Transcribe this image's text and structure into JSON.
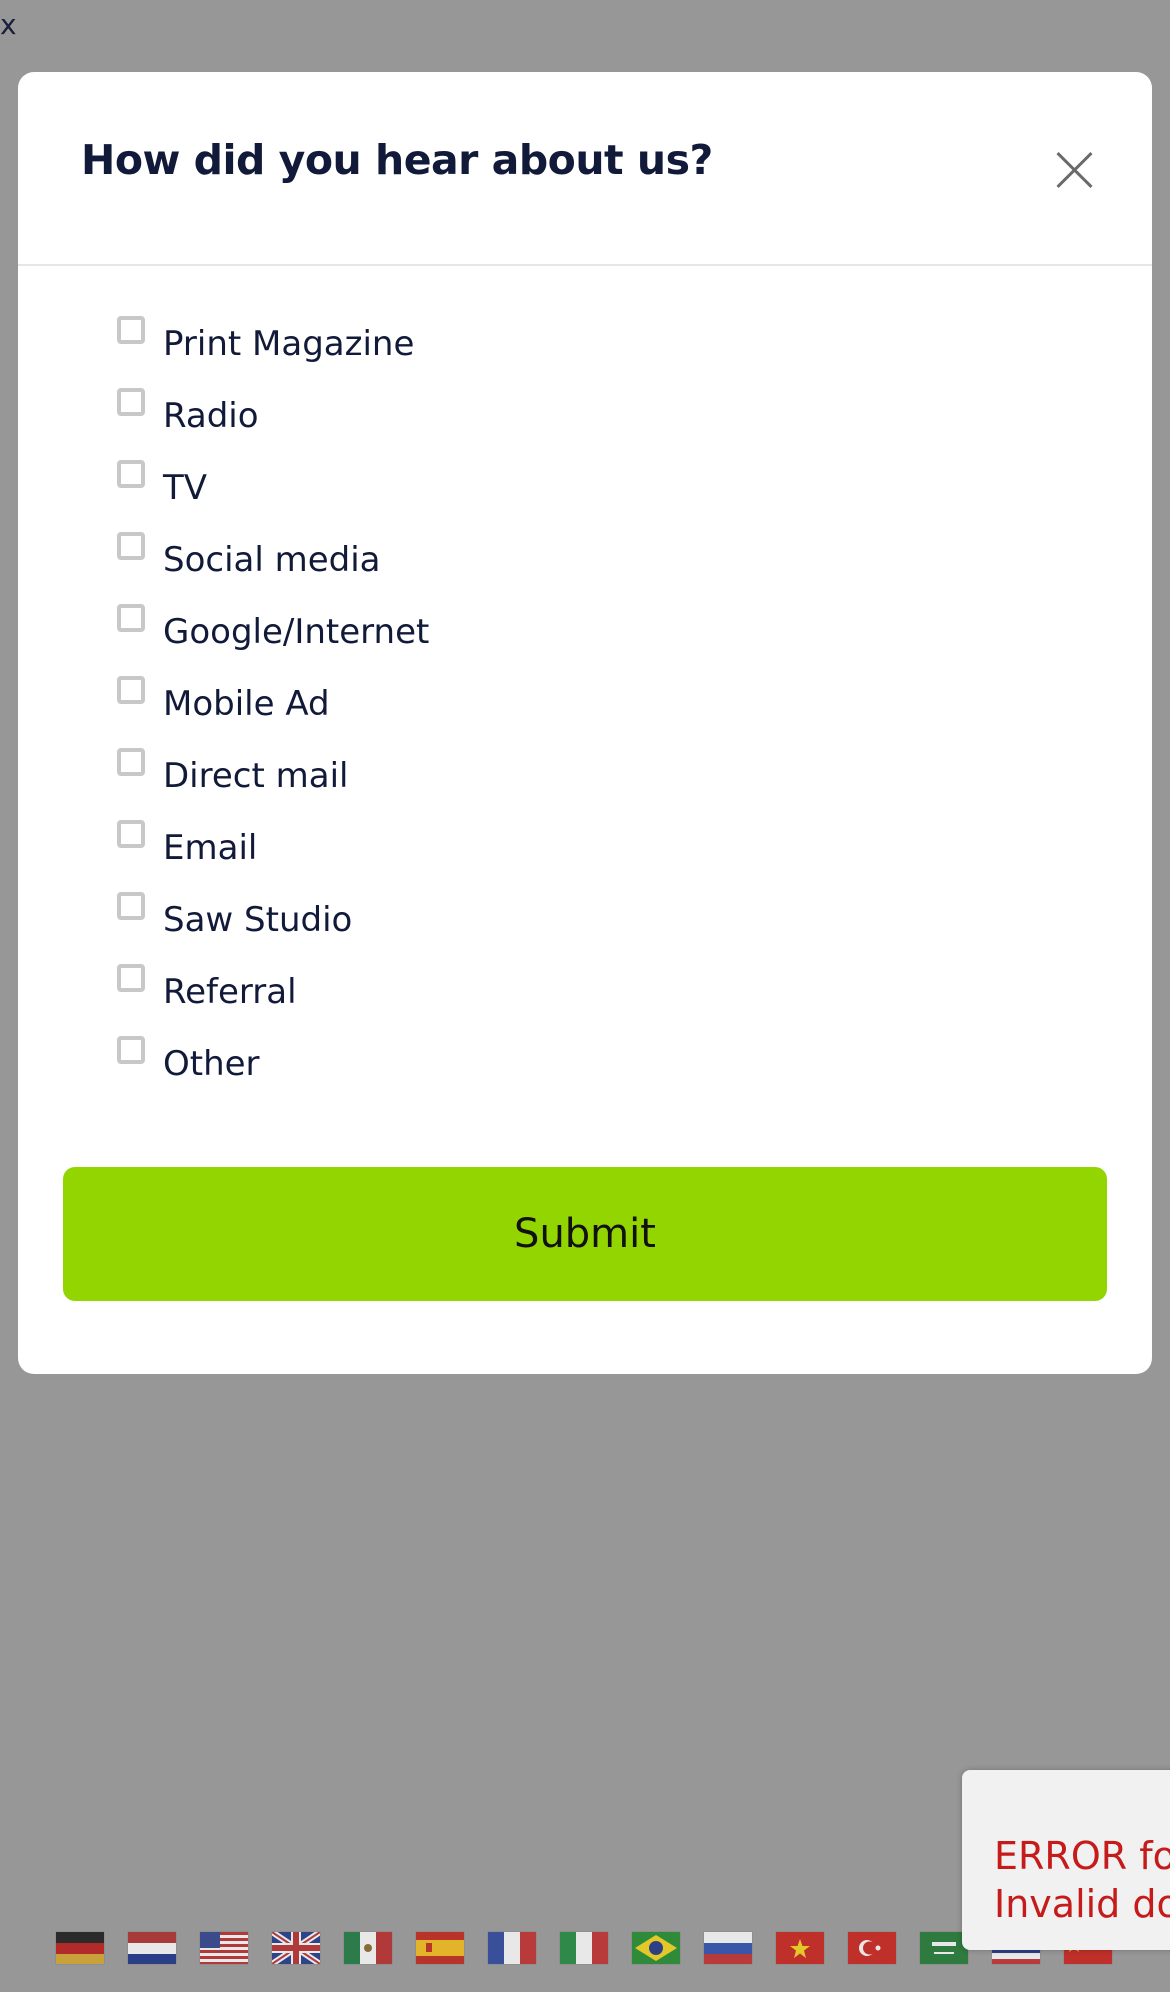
{
  "page": {
    "corner_label": "x"
  },
  "modal": {
    "title": "How did you hear about us?",
    "close_icon": "close-icon",
    "options": [
      {
        "label": "Print Magazine",
        "checked": false
      },
      {
        "label": "Radio",
        "checked": false
      },
      {
        "label": "TV",
        "checked": false
      },
      {
        "label": "Social media",
        "checked": false
      },
      {
        "label": "Google/Internet",
        "checked": false
      },
      {
        "label": "Mobile Ad",
        "checked": false
      },
      {
        "label": "Direct mail",
        "checked": false
      },
      {
        "label": "Email",
        "checked": false
      },
      {
        "label": "Saw Studio",
        "checked": false
      },
      {
        "label": "Referral",
        "checked": false
      },
      {
        "label": "Other",
        "checked": false
      }
    ],
    "submit_label": "Submit"
  },
  "error_toast": {
    "line1": "ERROR fo",
    "line2": "Invalid do"
  },
  "language_flags": [
    {
      "name": "germany-flag-icon"
    },
    {
      "name": "netherlands-flag-icon"
    },
    {
      "name": "usa-flag-icon"
    },
    {
      "name": "uk-flag-icon"
    },
    {
      "name": "mexico-flag-icon"
    },
    {
      "name": "spain-flag-icon"
    },
    {
      "name": "france-flag-icon"
    },
    {
      "name": "italy-flag-icon"
    },
    {
      "name": "brazil-flag-icon"
    },
    {
      "name": "russia-flag-icon"
    },
    {
      "name": "vietnam-flag-icon"
    },
    {
      "name": "turkey-flag-icon"
    },
    {
      "name": "saudi-arabia-flag-icon"
    },
    {
      "name": "thailand-flag-icon"
    },
    {
      "name": "china-flag-icon"
    }
  ],
  "colors": {
    "overlay": "#979797",
    "accent_green": "#93d500",
    "title_text": "#121a3a",
    "error_red": "#c51b1b"
  }
}
